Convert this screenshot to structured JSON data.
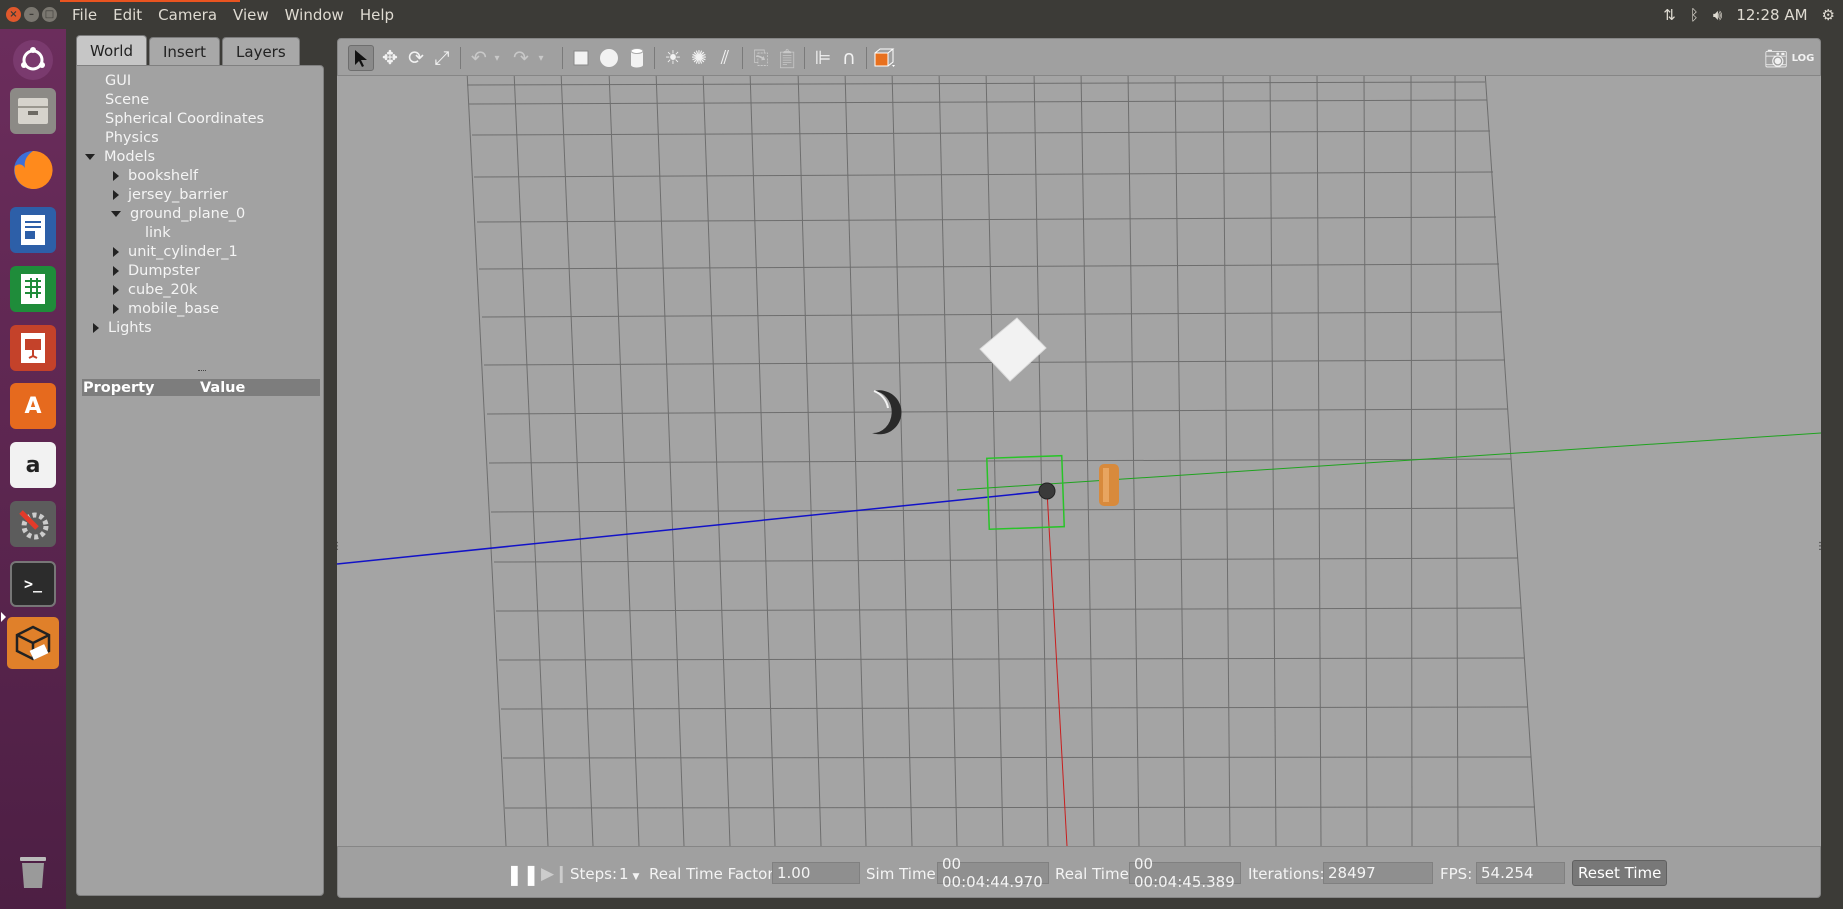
{
  "app": {
    "menus": [
      "File",
      "Edit",
      "Camera",
      "View",
      "Window",
      "Help"
    ],
    "clock": "12:28 AM"
  },
  "tray": {
    "icons": [
      "network-icon",
      "bluetooth-icon",
      "volume-icon",
      "settings-gear-icon"
    ]
  },
  "launcher": {
    "items": [
      "ubuntu-dash",
      "files",
      "firefox",
      "writer",
      "calc",
      "impress",
      "software-center",
      "amazon",
      "system-settings",
      "terminal",
      "gazebo",
      "trash"
    ]
  },
  "panel": {
    "tabs": [
      "World",
      "Insert",
      "Layers"
    ],
    "active_tab": "World",
    "tree": {
      "gui": "GUI",
      "scene": "Scene",
      "spherical": "Spherical Coordinates",
      "physics": "Physics",
      "models": "Models",
      "bookshelf": "bookshelf",
      "jersey": "jersey_barrier",
      "ground": "ground_plane_0",
      "link": "link",
      "cylinder": "unit_cylinder_1",
      "dumpster": "Dumpster",
      "cube": "cube_20k",
      "mobile": "mobile_base",
      "lights": "Lights"
    },
    "property_header": {
      "property": "Property",
      "value": "Value"
    }
  },
  "toolbar": {
    "tools": [
      "select",
      "translate",
      "rotate",
      "scale",
      "undo",
      "redo",
      "box",
      "sphere",
      "cylinder",
      "point-light",
      "spot-light",
      "directional-light",
      "copy",
      "paste",
      "align",
      "snap",
      "change-view",
      "screenshot",
      "log"
    ],
    "active_tool": "select"
  },
  "bottom": {
    "steps_label": "Steps:",
    "steps_value": "1",
    "rtf_label": "Real Time Factor:",
    "rtf_value": "1.00",
    "sim_label": "Sim Time:",
    "sim_value": "00 00:04:44.970",
    "real_label": "Real Time:",
    "real_value": "00 00:04:45.389",
    "iter_label": "Iterations:",
    "iter_value": "28497",
    "fps_label": "FPS:",
    "fps_value": "54.254",
    "reset_label": "Reset Time"
  },
  "colors": {
    "accent": "#e95420",
    "launcher": "#5e2750",
    "viewport_bg": "#a4a4a4",
    "axis_x": "#d02020",
    "axis_y": "#20b020",
    "axis_z": "#1010d0",
    "selection_box": "#28c428"
  }
}
